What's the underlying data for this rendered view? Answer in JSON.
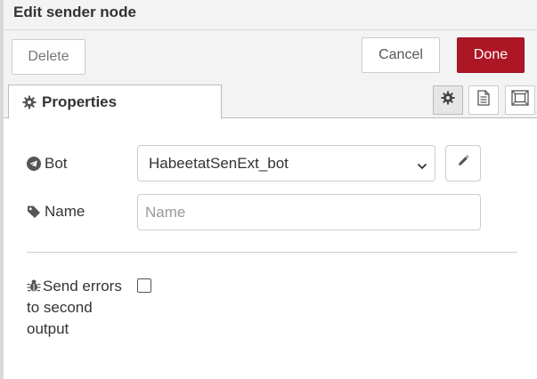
{
  "dialog": {
    "title": "Edit sender node"
  },
  "toolbar": {
    "delete_label": "Delete",
    "cancel_label": "Cancel",
    "done_label": "Done"
  },
  "tabs": {
    "properties_label": "Properties",
    "icons": [
      "gear-icon",
      "file-text-icon",
      "frame-icon"
    ]
  },
  "form": {
    "bot": {
      "label": "Bot",
      "icon": "telegram-icon",
      "value": "HabeetatSenExt_bot"
    },
    "name": {
      "label": "Name",
      "icon": "tag-icon",
      "value": "",
      "placeholder": "Name"
    },
    "send_errors": {
      "label": "Send errors to second output",
      "icon": "bug-icon",
      "checked": false
    }
  },
  "colors": {
    "done_button": "#ad1625",
    "header_bg": "#f3f3f3"
  }
}
